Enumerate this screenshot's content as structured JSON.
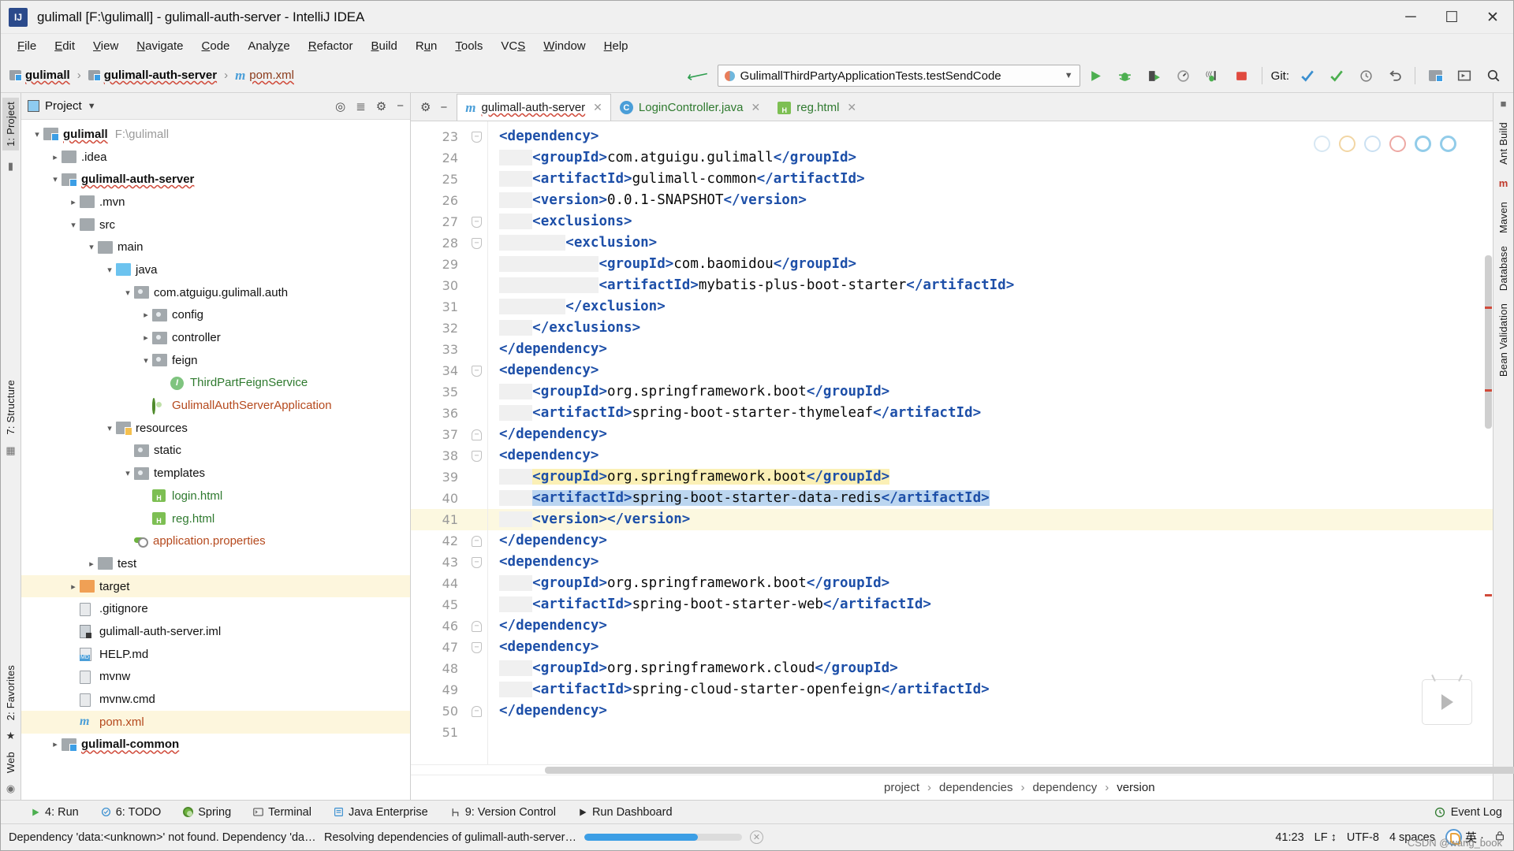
{
  "window": {
    "title": "gulimall [F:\\gulimall] - gulimall-auth-server - IntelliJ IDEA",
    "logo_text": "IJ",
    "minimize": "─",
    "maximize": "☐",
    "close": "✕"
  },
  "menubar": [
    {
      "label": "File",
      "key": "F"
    },
    {
      "label": "Edit",
      "key": "E"
    },
    {
      "label": "View",
      "key": "V"
    },
    {
      "label": "Navigate",
      "key": "N"
    },
    {
      "label": "Code",
      "key": "C"
    },
    {
      "label": "Analyze",
      "key": "z"
    },
    {
      "label": "Refactor",
      "key": "R"
    },
    {
      "label": "Build",
      "key": "B"
    },
    {
      "label": "Run",
      "key": "u"
    },
    {
      "label": "Tools",
      "key": "T"
    },
    {
      "label": "VCS",
      "key": "S"
    },
    {
      "label": "Window",
      "key": "W"
    },
    {
      "label": "Help",
      "key": "H"
    }
  ],
  "breadcrumbs": [
    {
      "label": "gulimall",
      "icon": "module-folder-icon"
    },
    {
      "label": "gulimall-auth-server",
      "icon": "module-folder-icon"
    },
    {
      "label": "pom.xml",
      "icon": "maven-m-icon"
    }
  ],
  "toolbar": {
    "wrench_icon": "build-wrench-icon",
    "run_configuration": "GulimallThirdPartyApplicationTests.testSendCode",
    "run_icon": "run-icon",
    "debug_icon": "debug-icon",
    "run_coverage_icon": "run-with-coverage-icon",
    "profiler_icon": "profiler-icon",
    "attach_icon": "attach-debugger-icon",
    "stop_icon": "stop-icon",
    "git_label": "Git:",
    "update_icon": "update-project-icon",
    "commit_icon": "commit-icon",
    "history_icon": "history-icon",
    "rollback_icon": "rollback-icon",
    "project_structure_icon": "project-structure-icon",
    "layout_icon": "layout-icon",
    "search_icon": "search-everywhere-icon"
  },
  "project_panel": {
    "header_title": "Project",
    "header_dropdown_icon": "chevron-down-icon",
    "locate_icon": "scroll-from-source-icon",
    "collapse_icon": "collapse-all-icon",
    "settings_icon": "gear-icon",
    "hide_icon": "hide-icon",
    "tree": [
      {
        "label": "gulimall",
        "suffix": "F:\\gulimall",
        "icon": "module-folder-icon",
        "indent": 0,
        "arrow": "open",
        "bold": true,
        "wavy": true
      },
      {
        "label": ".idea",
        "icon": "folder-icon",
        "indent": 1,
        "arrow": "closed"
      },
      {
        "label": "gulimall-auth-server",
        "icon": "module-folder-icon",
        "indent": 1,
        "arrow": "open",
        "bold": true,
        "wavy": true
      },
      {
        "label": ".mvn",
        "icon": "folder-icon",
        "indent": 2,
        "arrow": "closed"
      },
      {
        "label": "src",
        "icon": "folder-icon",
        "indent": 2,
        "arrow": "open"
      },
      {
        "label": "main",
        "icon": "folder-icon",
        "indent": 3,
        "arrow": "open"
      },
      {
        "label": "java",
        "icon": "source-folder-icon",
        "indent": 4,
        "arrow": "open"
      },
      {
        "label": "com.atguigu.gulimall.auth",
        "icon": "package-icon",
        "indent": 5,
        "arrow": "open"
      },
      {
        "label": "config",
        "icon": "package-icon",
        "indent": 6,
        "arrow": "closed"
      },
      {
        "label": "controller",
        "icon": "package-icon",
        "indent": 6,
        "arrow": "closed"
      },
      {
        "label": "feign",
        "icon": "package-icon",
        "indent": 6,
        "arrow": "open"
      },
      {
        "label": "ThirdPartFeignService",
        "icon": "interface-icon",
        "indent": 7,
        "arrow": "none",
        "color": "green"
      },
      {
        "label": "GulimallAuthServerApplication",
        "icon": "spring-bean-icon",
        "indent": 6,
        "arrow": "none",
        "color": "orange"
      },
      {
        "label": "resources",
        "icon": "resources-folder-icon",
        "indent": 4,
        "arrow": "open"
      },
      {
        "label": "static",
        "icon": "package-icon",
        "indent": 5,
        "arrow": "none"
      },
      {
        "label": "templates",
        "icon": "package-icon",
        "indent": 5,
        "arrow": "open"
      },
      {
        "label": "login.html",
        "icon": "html-file-icon",
        "indent": 6,
        "arrow": "none",
        "color": "green"
      },
      {
        "label": "reg.html",
        "icon": "html-file-icon",
        "indent": 6,
        "arrow": "none",
        "color": "green"
      },
      {
        "label": "application.properties",
        "icon": "spring-properties-icon",
        "indent": 5,
        "arrow": "none",
        "color": "orange"
      },
      {
        "label": "test",
        "icon": "folder-icon",
        "indent": 3,
        "arrow": "closed"
      },
      {
        "label": "target",
        "icon": "target-folder-icon",
        "indent": 2,
        "arrow": "closed",
        "highlight": true
      },
      {
        "label": ".gitignore",
        "icon": "file-icon",
        "indent": 2,
        "arrow": "none"
      },
      {
        "label": "gulimall-auth-server.iml",
        "icon": "iml-file-icon",
        "indent": 2,
        "arrow": "none"
      },
      {
        "label": "HELP.md",
        "icon": "markdown-file-icon",
        "indent": 2,
        "arrow": "none"
      },
      {
        "label": "mvnw",
        "icon": "file-icon",
        "indent": 2,
        "arrow": "none"
      },
      {
        "label": "mvnw.cmd",
        "icon": "file-icon",
        "indent": 2,
        "arrow": "none"
      },
      {
        "label": "pom.xml",
        "icon": "maven-m-icon",
        "indent": 2,
        "arrow": "none",
        "color": "orange",
        "highlight": true
      },
      {
        "label": "gulimall-common",
        "icon": "module-folder-icon",
        "indent": 1,
        "arrow": "closed",
        "bold": true,
        "wavy": true
      }
    ]
  },
  "left_rail": {
    "top_items": [
      {
        "label": "1: Project",
        "selected": true
      }
    ],
    "mid_items": [
      {
        "label": "7: Structure"
      }
    ],
    "bottom_items": [
      {
        "label": "2: Favorites"
      },
      {
        "label": "Web"
      }
    ]
  },
  "right_rail": {
    "items": [
      "Ant Build",
      "Maven",
      "Database",
      "Bean Validation"
    ]
  },
  "editor": {
    "tabs": [
      {
        "label": "gulimall-auth-server",
        "icon": "maven-m-icon",
        "active": true,
        "wavy": true
      },
      {
        "label": "LoginController.java",
        "icon": "java-class-icon",
        "active": false
      },
      {
        "label": "reg.html",
        "icon": "html-file-icon",
        "active": false
      }
    ],
    "gear_icon": "gear-icon",
    "minimize_icon": "hide-icon",
    "current_line": 41,
    "lines": [
      {
        "n": 23,
        "indent": 0,
        "fold": "start",
        "code": [
          [
            "tag",
            "<dependency>"
          ]
        ]
      },
      {
        "n": 24,
        "indent": 1,
        "code": [
          [
            "tag",
            "<groupId>"
          ],
          [
            "txt",
            "com.atguigu.gulimall"
          ],
          [
            "tag",
            "</groupId>"
          ]
        ]
      },
      {
        "n": 25,
        "indent": 1,
        "code": [
          [
            "tag",
            "<artifactId>"
          ],
          [
            "txt",
            "gulimall-common"
          ],
          [
            "tag",
            "</artifactId>"
          ]
        ]
      },
      {
        "n": 26,
        "indent": 1,
        "code": [
          [
            "tag",
            "<version>"
          ],
          [
            "txt",
            "0.0.1-SNAPSHOT"
          ],
          [
            "tag",
            "</version>"
          ]
        ]
      },
      {
        "n": 27,
        "indent": 1,
        "fold": "start",
        "code": [
          [
            "tag",
            "<exclusions>"
          ]
        ]
      },
      {
        "n": 28,
        "indent": 2,
        "fold": "start",
        "code": [
          [
            "tag",
            "<exclusion>"
          ]
        ]
      },
      {
        "n": 29,
        "indent": 3,
        "code": [
          [
            "tag",
            "<groupId>"
          ],
          [
            "txt",
            "com.baomidou"
          ],
          [
            "tag",
            "</groupId>"
          ]
        ]
      },
      {
        "n": 30,
        "indent": 3,
        "code": [
          [
            "tag",
            "<artifactId>"
          ],
          [
            "txt",
            "mybatis-plus-boot-starter"
          ],
          [
            "tag",
            "</artifactId>"
          ]
        ]
      },
      {
        "n": 31,
        "indent": 2,
        "code": [
          [
            "tag",
            "</exclusion>"
          ]
        ]
      },
      {
        "n": 32,
        "indent": 1,
        "code": [
          [
            "tag",
            "</exclusions>"
          ]
        ]
      },
      {
        "n": 33,
        "indent": 0,
        "code": [
          [
            "tag",
            "</dependency>"
          ]
        ]
      },
      {
        "n": 34,
        "indent": 0,
        "fold": "start",
        "code": [
          [
            "tag",
            "<dependency>"
          ]
        ]
      },
      {
        "n": 35,
        "indent": 1,
        "code": [
          [
            "tag",
            "<groupId>"
          ],
          [
            "txt",
            "org.springframework.boot"
          ],
          [
            "tag",
            "</groupId>"
          ]
        ]
      },
      {
        "n": 36,
        "indent": 1,
        "code": [
          [
            "tag",
            "<artifactId>"
          ],
          [
            "txt",
            "spring-boot-starter-thymeleaf"
          ],
          [
            "tag",
            "</artifactId>"
          ]
        ]
      },
      {
        "n": 37,
        "indent": 0,
        "fold": "end",
        "code": [
          [
            "tag",
            "</dependency>"
          ]
        ]
      },
      {
        "n": 38,
        "indent": 0,
        "fold": "start",
        "code": [
          [
            "tag",
            "<dependency>"
          ]
        ]
      },
      {
        "n": 39,
        "indent": 1,
        "highlight": "yellow",
        "code": [
          [
            "tag",
            "<groupId>"
          ],
          [
            "txt",
            "org.springframework.boot"
          ],
          [
            "tag",
            "</groupId>"
          ]
        ]
      },
      {
        "n": 40,
        "indent": 1,
        "highlight": "selected",
        "code": [
          [
            "tag",
            "<artifactId>"
          ],
          [
            "txt",
            "spring-boot-starter-data-redis"
          ],
          [
            "tag",
            "</artifactId>"
          ]
        ]
      },
      {
        "n": 41,
        "indent": 1,
        "current": true,
        "code": [
          [
            "tag",
            "<version>"
          ],
          [
            "tag",
            "</version>"
          ]
        ]
      },
      {
        "n": 42,
        "indent": 0,
        "fold": "end",
        "code": [
          [
            "tag",
            "</dependency>"
          ]
        ]
      },
      {
        "n": 43,
        "indent": 0,
        "fold": "start",
        "code": [
          [
            "tag",
            "<dependency>"
          ]
        ]
      },
      {
        "n": 44,
        "indent": 1,
        "code": [
          [
            "tag",
            "<groupId>"
          ],
          [
            "txt",
            "org.springframework.boot"
          ],
          [
            "tag",
            "</groupId>"
          ]
        ]
      },
      {
        "n": 45,
        "indent": 1,
        "code": [
          [
            "tag",
            "<artifactId>"
          ],
          [
            "txt",
            "spring-boot-starter-web"
          ],
          [
            "tag",
            "</artifactId>"
          ]
        ]
      },
      {
        "n": 46,
        "indent": 0,
        "fold": "end",
        "code": [
          [
            "tag",
            "</dependency>"
          ]
        ]
      },
      {
        "n": 47,
        "indent": 0,
        "fold": "start",
        "code": [
          [
            "tag",
            "<dependency>"
          ]
        ]
      },
      {
        "n": 48,
        "indent": 1,
        "code": [
          [
            "tag",
            "<groupId>"
          ],
          [
            "txt",
            "org.springframework.cloud"
          ],
          [
            "tag",
            "</groupId>"
          ]
        ]
      },
      {
        "n": 49,
        "indent": 1,
        "code": [
          [
            "tag",
            "<artifactId>"
          ],
          [
            "txt",
            "spring-cloud-starter-openfeign"
          ],
          [
            "tag",
            "</artifactId>"
          ]
        ]
      },
      {
        "n": 50,
        "indent": 0,
        "fold": "end",
        "code": [
          [
            "tag",
            "</dependency>"
          ]
        ]
      },
      {
        "n": 51,
        "indent": 0,
        "code": []
      }
    ],
    "breadcrumbs": [
      "project",
      "dependencies",
      "dependency",
      "version"
    ],
    "browser_preview_icons": [
      "chrome-icon",
      "firefox-icon",
      "safari-icon",
      "opera-icon",
      "edge-icon",
      "explorer-icon"
    ]
  },
  "tool_windows": [
    {
      "label": "4: Run",
      "icon": "run-icon"
    },
    {
      "label": "6: TODO",
      "icon": "todo-icon"
    },
    {
      "label": "Spring",
      "icon": "spring-icon"
    },
    {
      "label": "Terminal",
      "icon": "terminal-icon"
    },
    {
      "label": "Java Enterprise",
      "icon": "java-enterprise-icon"
    },
    {
      "label": "9: Version Control",
      "icon": "version-control-icon"
    },
    {
      "label": "Run Dashboard",
      "icon": "run-dashboard-icon"
    }
  ],
  "event_log": {
    "label": "Event Log",
    "icon": "event-log-icon"
  },
  "status_bar": {
    "message": "Dependency 'data:<unknown>' not found. Dependency 'data:<unknown>' not foun…",
    "progress_text": "Resolving dependencies of gulimall-auth-server…",
    "progress_percent": 72,
    "cancel_icon": "cancel-icon",
    "caret_position": "41:23",
    "line_separator": "LF",
    "encoding": "UTF-8",
    "indent": "4 spaces",
    "ime_icon": "ime-icon",
    "ime_label": "英",
    "ime_extra": "·",
    "lock_icon": "lock-icon"
  },
  "watermark": "CSDN @wang_book"
}
